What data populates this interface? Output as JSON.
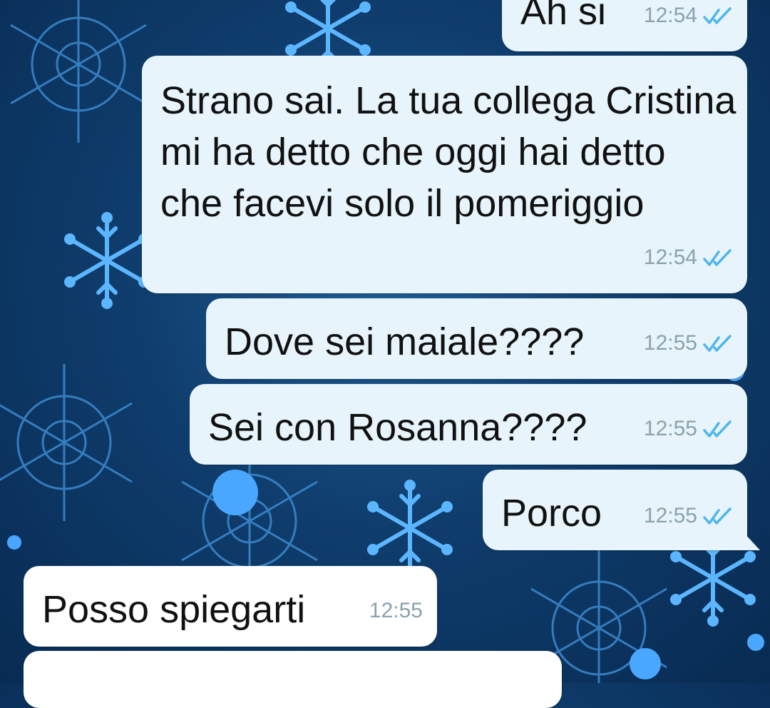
{
  "chat": {
    "messages": [
      {
        "text": "Ah si",
        "time": "12:54",
        "direction": "outgoing",
        "status": "read"
      },
      {
        "text": "Strano sai. La tua collega Cristina mi ha detto che oggi hai detto che facevi solo il pomeriggio",
        "time": "12:54",
        "direction": "outgoing",
        "status": "read"
      },
      {
        "text": "Dove sei maiale????",
        "time": "12:55",
        "direction": "outgoing",
        "status": "read"
      },
      {
        "text": "Sei con Rosanna????",
        "time": "12:55",
        "direction": "outgoing",
        "status": "read"
      },
      {
        "text": "Porco",
        "time": "12:55",
        "direction": "outgoing",
        "status": "read"
      },
      {
        "text": "Posso spiegarti",
        "time": "12:55",
        "direction": "incoming"
      }
    ]
  },
  "colors": {
    "outgoing_bubble": "#e7f4fb",
    "incoming_bubble": "#ffffff",
    "read_ticks": "#4fb6ec",
    "timestamp": "#8aa2ad",
    "wallpaper": "#0f3d6d"
  }
}
